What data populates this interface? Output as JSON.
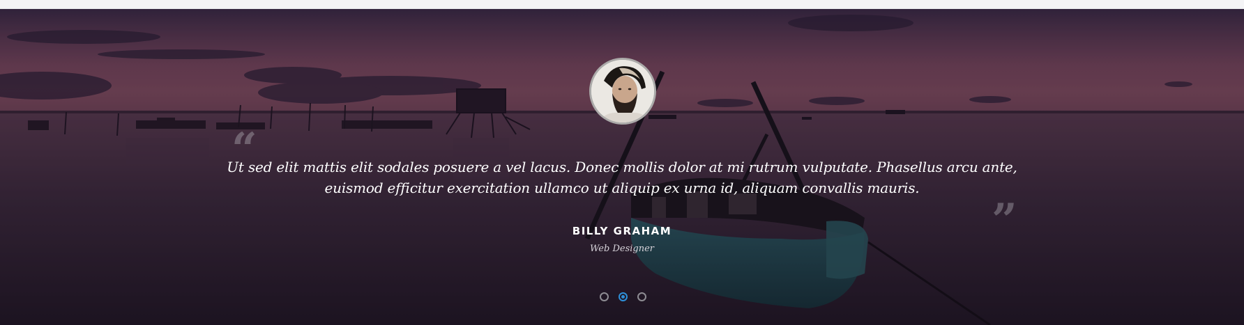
{
  "testimonial": {
    "quote_open": "“",
    "quote_close": "”",
    "text": "Ut sed elit mattis elit sodales posuere a vel lacus. Donec mollis dolor at mi rutrum vulputate. Phasellus arcu ante, euismod efficitur exercitation ullamco ut aliquip ex urna id, aliquam convallis mauris.",
    "author_name": "BILLY GRAHAM",
    "author_role": "Web Designer"
  },
  "carousel": {
    "slides": 3,
    "active_index": 2
  },
  "colors": {
    "accent": "#2e8fd8",
    "text": "#ffffff"
  }
}
